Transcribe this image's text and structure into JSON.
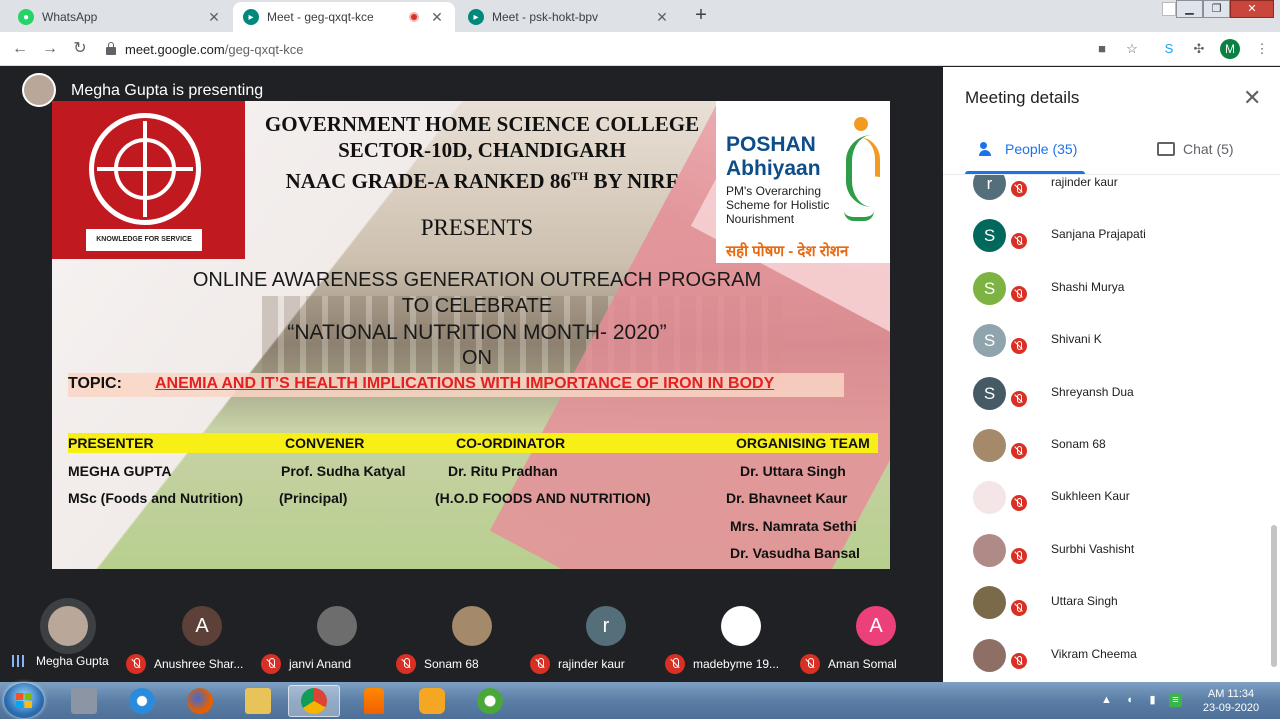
{
  "tabs": [
    {
      "title": "WhatsApp",
      "active": false
    },
    {
      "title": "Meet - geg-qxqt-kce",
      "active": true
    },
    {
      "title": "Meet - psk-hokt-bpv",
      "active": false
    }
  ],
  "address": {
    "host": "meet.google.com",
    "path": "/geg-qxqt-kce"
  },
  "profile_initial": "M",
  "stage": {
    "presenting_text": "Megha Gupta is presenting"
  },
  "slide": {
    "college_l1": "GOVERNMENT HOME SCIENCE COLLEGE",
    "college_l2": "SECTOR-10D, CHANDIGARH",
    "college_l3_a": "NAAC GRADE-A RANKED 86",
    "college_l3_sup": "TH",
    "college_l3_b": " BY NIRF",
    "logo_motto": "KNOWLEDGE FOR SERVICE",
    "poshan_l1": "POSHAN",
    "poshan_l2": "Abhiyaan",
    "poshan_sub_l1": "PM's Overarching",
    "poshan_sub_l2": "Scheme for Holistic",
    "poshan_sub_l3": "Nourishment",
    "poshan_hindi": "सही पोषण - देश रोशन",
    "presents": "PRESENTS",
    "line1": "ONLINE AWARENESS GENERATION OUTREACH PROGRAM",
    "line2": "TO CELEBRATE",
    "line3": "“NATIONAL NUTRITION MONTH- 2020”",
    "line4": "ON",
    "topic_label": "TOPIC:",
    "topic_text": "ANEMIA AND IT’S HEALTH IMPLICATIONS WITH IMPORTANCE OF IRON IN BODY",
    "roles": [
      "PRESENTER",
      "CONVENER",
      "CO-ORDINATOR",
      "ORGANISING TEAM"
    ],
    "presenter_name": "MEGHA GUPTA",
    "presenter_qual": "MSc (Foods and Nutrition)",
    "convener_name": "Prof. Sudha Katyal",
    "convener_role": "(Principal)",
    "coordinator_name": "Dr. Ritu Pradhan",
    "coordinator_role": "(H.O.D FOODS AND NUTRITION)",
    "team": [
      "Dr. Uttara Singh",
      "Dr. Bhavneet Kaur",
      "Mrs. Namrata Sethi",
      "Dr. Vasudha Bansal"
    ]
  },
  "strip": [
    {
      "name": "Megha Gupta",
      "initial": "",
      "color": "#b9a89a",
      "muted": false
    },
    {
      "name": "Anushree Shar...",
      "initial": "A",
      "color": "#5d4037",
      "muted": true
    },
    {
      "name": "janvi Anand",
      "initial": "",
      "color": "#6d6d6d",
      "muted": true
    },
    {
      "name": "Sonam 68",
      "initial": "",
      "color": "#a48a6a",
      "muted": true
    },
    {
      "name": "rajinder kaur",
      "initial": "r",
      "color": "#546e7a",
      "muted": true
    },
    {
      "name": "madebyme 19...",
      "initial": "",
      "color": "#ffffff",
      "muted": true
    },
    {
      "name": "Aman Somal",
      "initial": "A",
      "color": "#ec407a",
      "muted": true
    }
  ],
  "panel": {
    "title": "Meeting details",
    "people_tab": "People (35)",
    "chat_tab": "Chat (5)",
    "people": [
      {
        "name": "rajinder kaur",
        "initial": "r",
        "color": "#546e7a"
      },
      {
        "name": "Sanjana Prajapati",
        "initial": "S",
        "color": "#00695c"
      },
      {
        "name": "Shashi Murya",
        "initial": "S",
        "color": "#7cb342"
      },
      {
        "name": "Shivani K",
        "initial": "S",
        "color": "#90a4ae"
      },
      {
        "name": "Shreyansh Dua",
        "initial": "S",
        "color": "#455a64"
      },
      {
        "name": "Sonam 68",
        "initial": "",
        "color": "#a48a6a"
      },
      {
        "name": "Sukhleen Kaur",
        "initial": "",
        "color": "#f4e6e6"
      },
      {
        "name": "Surbhi Vashisht",
        "initial": "",
        "color": "#b08a86"
      },
      {
        "name": "Uttara Singh",
        "initial": "",
        "color": "#7a6a4a"
      },
      {
        "name": "Vikram Cheema",
        "initial": "",
        "color": "#8e6f66"
      }
    ]
  },
  "taskbar": {
    "time": "AM 11:34",
    "date": "23-09-2020"
  }
}
